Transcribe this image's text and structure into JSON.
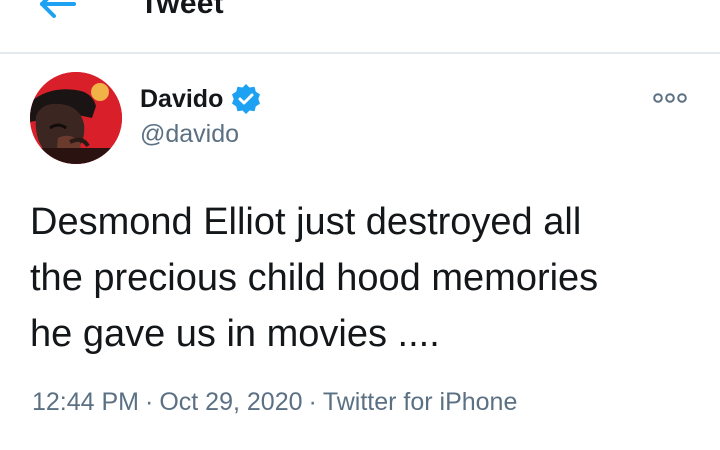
{
  "header": {
    "title": "Tweet",
    "back_icon": "arrow-left-icon",
    "accent_color": "#1da1f2"
  },
  "author": {
    "display_name": "Davido",
    "handle": "@davido",
    "verified_icon": "verified-badge-icon",
    "avatar_bg": "#d91f2a"
  },
  "more_icon": "more-options-icon",
  "tweet": {
    "text": "Desmond Elliot just destroyed all\nthe precious child hood memories\nhe gave us in movies ....",
    "time": "12:44 PM",
    "separator": "·",
    "date": "Oct 29, 2020",
    "source": "Twitter for iPhone"
  }
}
